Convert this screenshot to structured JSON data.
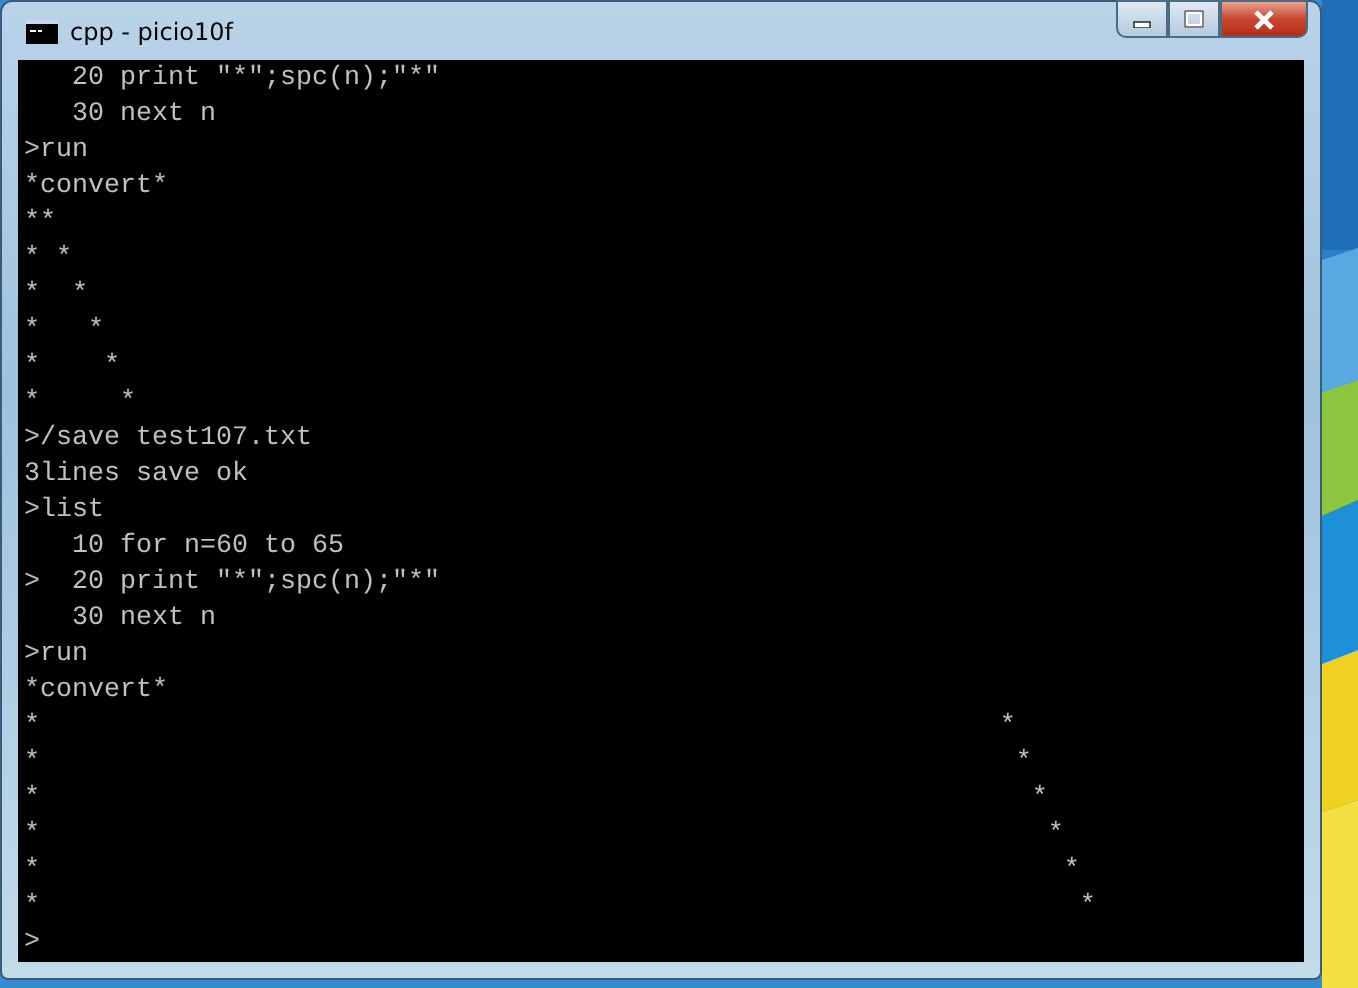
{
  "window": {
    "title": "cpp - picio10f"
  },
  "console": {
    "lines": [
      "   20 print \"*\";spc(n);\"*\"",
      "   30 next n",
      ">run",
      "*convert*",
      "**",
      "* *",
      "*  *",
      "*   *",
      "*    *",
      "*     *",
      ">/save test107.txt",
      "3lines save ok",
      ">list",
      "   10 for n=60 to 65",
      ">  20 print \"*\";spc(n);\"*\"",
      "   30 next n",
      ">run",
      "*convert*",
      "*                                                            *",
      "*                                                             *",
      "*                                                              *",
      "*                                                               *",
      "*                                                                *",
      "*                                                                 *",
      ">"
    ]
  }
}
